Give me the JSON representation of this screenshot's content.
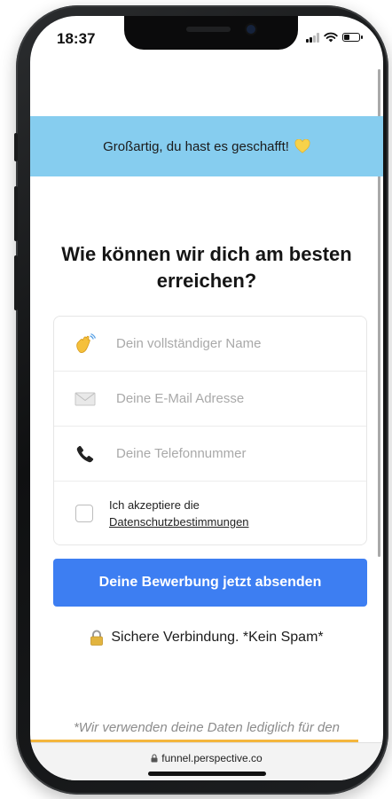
{
  "status_bar": {
    "time": "18:37",
    "battery_level": 0.4
  },
  "banner": {
    "text": "Großartig, du hast es geschafft!",
    "icon": "yellow-heart-icon",
    "color": "#86cdef"
  },
  "form": {
    "title": "Wie können wir dich am besten erreichen?",
    "fields": [
      {
        "icon": "waving-hand-icon",
        "placeholder": "Dein vollständiger Name",
        "value": ""
      },
      {
        "icon": "envelope-icon",
        "placeholder": "Deine E-Mail Adresse",
        "value": ""
      },
      {
        "icon": "phone-icon",
        "placeholder": "Deine Telefonnummer",
        "value": ""
      }
    ],
    "consent": {
      "text": "Ich akzeptiere die",
      "link_text": "Datenschutzbestimmungen",
      "checked": false
    },
    "submit_label": "Deine Bewerbung jetzt absenden",
    "submit_color": "#3d7ef2"
  },
  "secure_note": {
    "icon": "lock-icon",
    "text": "Sichere Verbindung. *Kein Spam*"
  },
  "footnote": "*Wir verwenden deine Daten lediglich für den",
  "progress": {
    "fraction": 0.93,
    "color": "#f4b63d"
  },
  "browser": {
    "url": "funnel.perspective.co",
    "url_icon": "lock-icon"
  }
}
